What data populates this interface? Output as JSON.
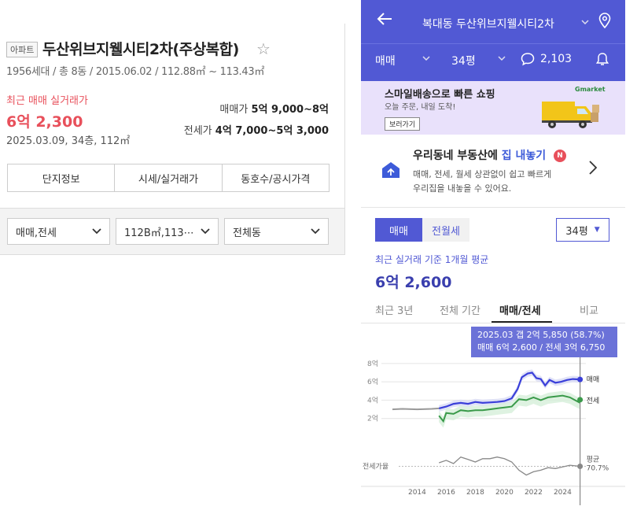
{
  "left": {
    "badge": "아파트",
    "title": "두산위브지웰시티2차(주상복합)",
    "meta": "1956세대 / 총 8동 / 2015.06.02 / 112.88㎡ ~ 113.43㎡",
    "recent_label": "최근 매매 실거래가",
    "recent_price": "6억 2,300",
    "recent_date": "2025.03.09, 34층, 112㎡",
    "sale_range_label": "매매가",
    "sale_range": "5억 9,000~8억",
    "jeonse_range_label": "전세가",
    "jeonse_range": "4억 7,000~5억 3,000",
    "tabs": [
      "단지정보",
      "시세/실거래가",
      "동호수/공시가격"
    ],
    "filters": [
      "매매,전세",
      "112B㎡,113⋯",
      "전체동"
    ]
  },
  "right": {
    "header_title": "복대동 두산위브지웰시티2차",
    "deal_type": "매매",
    "size": "34평",
    "comment_count": "2,103",
    "ad": {
      "title": "스마일배송으로 빠른 쇼핑",
      "subtitle": "오늘 주문, 내일 도착!",
      "button": "보러가기",
      "brand": "Gmarket"
    },
    "promo": {
      "title_prefix": "우리동네 부동산에",
      "title_highlight": "집 내놓기",
      "badge": "N",
      "desc1": "매매, 전세, 월세 상관없이 쉽고 빠르게",
      "desc2": "우리집을 내놓을 수 있어요."
    },
    "segment": [
      "매매",
      "전월세"
    ],
    "size_select": "34평",
    "avg_label": "최근 실거래 기준 1개월 평균",
    "avg_price": "6억 2,600",
    "chart_tabs": [
      "최근 3년",
      "전체 기간",
      "매매/전세",
      "비교"
    ],
    "tooltip_line1": "2025.03  갭 2억 5,850 (58.7%)",
    "tooltip_line2": "매매 6억 2,600 / 전세 3억 6,750"
  },
  "colors": {
    "brand": "#5159d4",
    "sale": "#3a3fd9",
    "jeonse": "#3a9a4a",
    "price_red": "#e8505b"
  },
  "chart_data": {
    "type": "line",
    "x_ticks": [
      "2014",
      "2016",
      "2018",
      "2020",
      "2022",
      "2024"
    ],
    "y_ticks": [
      "8억",
      "6억",
      "4억",
      "2억"
    ],
    "ylim": [
      0,
      8.5
    ],
    "xlim": [
      2012.3,
      2025.6
    ],
    "ratio_label": "전세가율",
    "ratio_end_label": "평균",
    "ratio_end_value": "70.7%",
    "series": [
      {
        "name": "매매",
        "x": [
          2012.3,
          2013,
          2014,
          2015,
          2015.5,
          2016,
          2016.5,
          2017,
          2017.5,
          2018,
          2018.5,
          2019,
          2019.5,
          2020,
          2020.5,
          2020.9,
          2021.2,
          2021.6,
          2021.9,
          2022.2,
          2022.5,
          2022.8,
          2023.1,
          2023.5,
          2023.9,
          2024.3,
          2024.7,
          2025.2
        ],
        "y": [
          3.0,
          3.05,
          3.0,
          3.05,
          3.1,
          3.3,
          3.6,
          3.7,
          3.6,
          3.8,
          3.7,
          3.75,
          3.8,
          3.9,
          4.2,
          5.2,
          6.5,
          6.9,
          7.0,
          6.4,
          6.3,
          5.6,
          6.2,
          5.9,
          6.0,
          6.2,
          6.3,
          6.26
        ]
      },
      {
        "name": "전세",
        "x": [
          2015.5,
          2015.8,
          2016,
          2016.5,
          2017,
          2017.5,
          2018,
          2018.5,
          2019,
          2019.5,
          2020,
          2020.5,
          2021,
          2021.5,
          2022,
          2022.5,
          2023,
          2023.5,
          2024,
          2024.5,
          2025.2
        ],
        "y": [
          2.3,
          1.7,
          2.6,
          2.5,
          2.9,
          2.8,
          2.9,
          2.9,
          3.0,
          3.1,
          3.2,
          3.3,
          4.1,
          4.0,
          4.3,
          4.0,
          4.3,
          4.4,
          4.5,
          4.3,
          3.7
        ]
      },
      {
        "name": "전세가율",
        "x": [
          2015.5,
          2016,
          2016.5,
          2017,
          2017.5,
          2018,
          2018.5,
          2019,
          2019.5,
          2020,
          2020.5,
          2021,
          2021.5,
          2022,
          2022.5,
          2023,
          2023.5,
          2024,
          2024.5,
          2025.2
        ],
        "y": [
          0.75,
          0.78,
          0.74,
          0.82,
          0.79,
          0.76,
          0.8,
          0.8,
          0.82,
          0.8,
          0.76,
          0.66,
          0.6,
          0.64,
          0.66,
          0.69,
          0.68,
          0.7,
          0.72,
          0.707
        ]
      }
    ]
  }
}
